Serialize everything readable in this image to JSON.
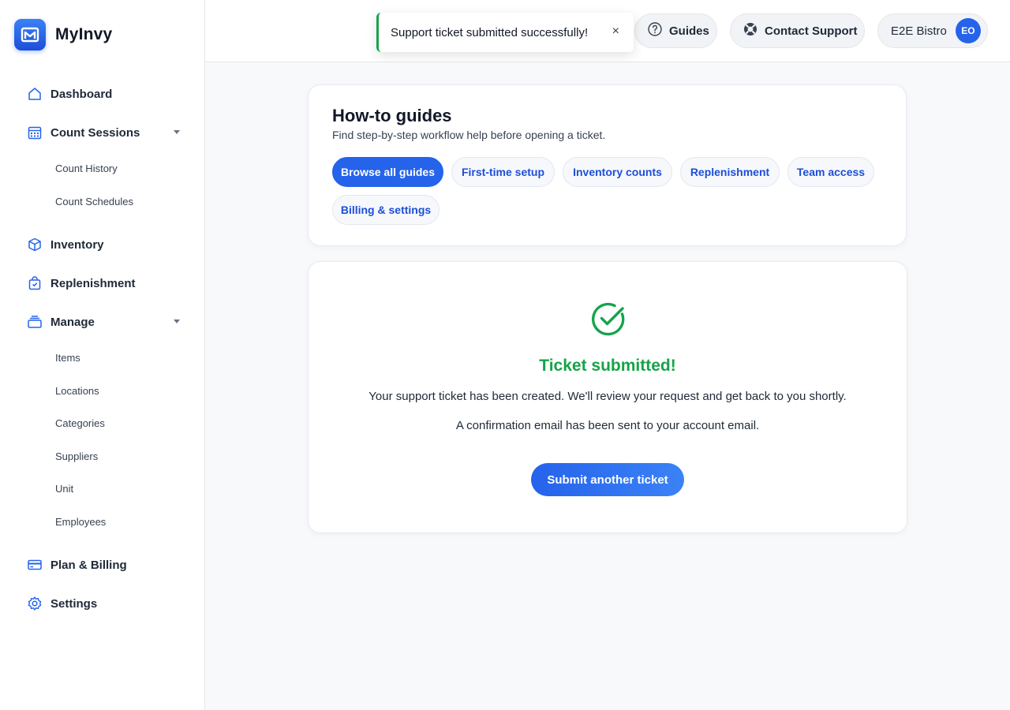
{
  "brand": {
    "name": "MyInvy"
  },
  "sidebar": {
    "items": [
      {
        "label": "Dashboard",
        "icon": "home-icon"
      },
      {
        "label": "Count Sessions",
        "icon": "calendar-icon",
        "expanded": true,
        "children": [
          "Count History",
          "Count Schedules"
        ]
      },
      {
        "label": "Inventory",
        "icon": "box-icon"
      },
      {
        "label": "Replenishment",
        "icon": "shopping-bag-icon"
      },
      {
        "label": "Manage",
        "icon": "layers-icon",
        "expanded": true,
        "children": [
          "Items",
          "Locations",
          "Categories",
          "Suppliers",
          "Unit",
          "Employees"
        ]
      },
      {
        "label": "Plan & Billing",
        "icon": "credit-card-icon"
      },
      {
        "label": "Settings",
        "icon": "gear-icon"
      }
    ]
  },
  "header": {
    "guides_label": "Guides",
    "contact_label": "Contact Support",
    "account_name": "E2E Bistro",
    "account_initials": "EO"
  },
  "toast": {
    "message": "Support ticket submitted successfully!",
    "close": "×"
  },
  "guides": {
    "title": "How-to guides",
    "subtitle": "Find step-by-step workflow help before opening a ticket.",
    "chips": [
      "Browse all guides",
      "First-time setup",
      "Inventory counts",
      "Replenishment",
      "Team access",
      "Billing & settings"
    ],
    "active_chip": "Browse all guides"
  },
  "confirmation": {
    "title": "Ticket submitted!",
    "message": "Your support ticket has been created. We'll review your request and get back to you shortly.",
    "email_note": "A confirmation email has been sent to your account email.",
    "button": "Submit another ticket"
  },
  "colors": {
    "accent": "#2563eb",
    "success": "#16a34a"
  }
}
